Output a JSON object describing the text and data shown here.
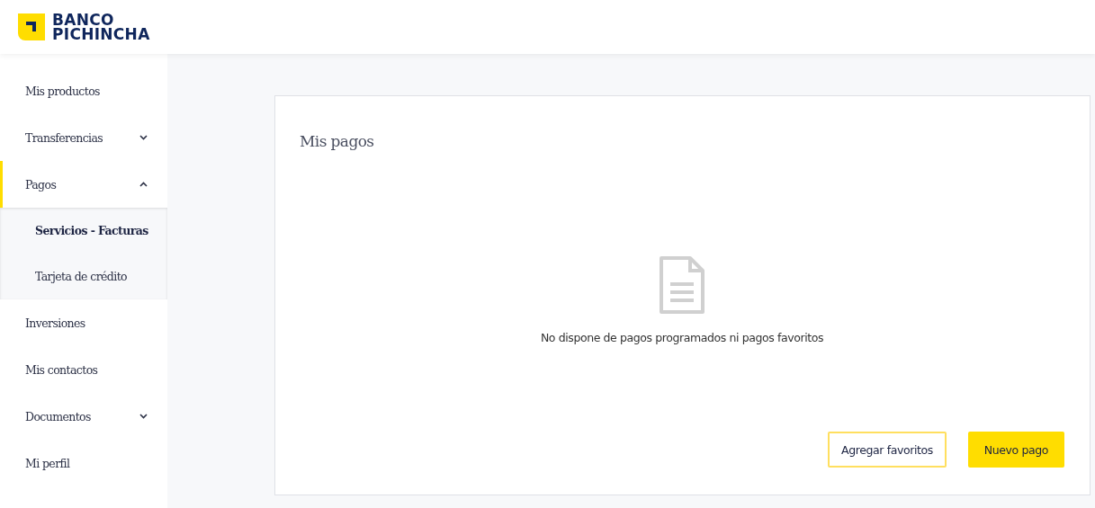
{
  "header": {
    "logo_line_1": "BANCO",
    "logo_line_2": "PICHINCHA"
  },
  "sidebar": {
    "items": [
      {
        "kind": "link",
        "label": "Mis productos",
        "selected": false
      },
      {
        "kind": "group",
        "label": "Transferencias",
        "selected": false,
        "expanded": false
      },
      {
        "kind": "group",
        "label": "Pagos",
        "selected": true,
        "expanded": true,
        "children": [
          {
            "label": "Servicios - Facturas",
            "selected": true
          },
          {
            "label": "Tarjeta de crédito",
            "selected": false
          }
        ]
      },
      {
        "kind": "link",
        "label": "Inversiones",
        "selected": false
      },
      {
        "kind": "link",
        "label": "Mis contactos",
        "selected": false
      },
      {
        "kind": "group",
        "label": "Documentos",
        "selected": false,
        "expanded": false
      },
      {
        "kind": "link",
        "label": "Mi perfil",
        "selected": false
      }
    ]
  },
  "card": {
    "title": "Mis pagos",
    "empty_message": "No dispone de pagos programados ni pagos favoritos",
    "buttons": [
      {
        "label": "Agregar favoritos",
        "kind": "secondary"
      },
      {
        "label": "Nuevo pago",
        "kind": "primary"
      }
    ]
  }
}
